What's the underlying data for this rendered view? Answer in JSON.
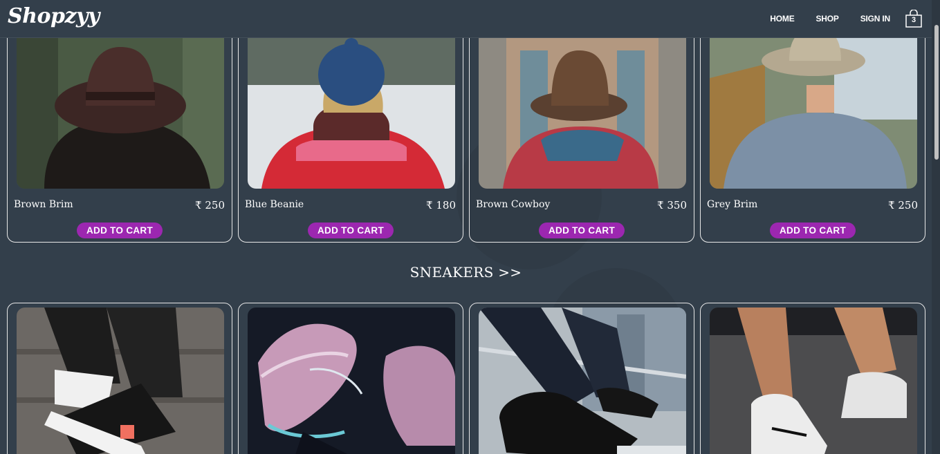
{
  "header": {
    "logo": "Shopzyy",
    "nav": [
      "HOME",
      "SHOP",
      "SIGN IN"
    ],
    "cart_count": "3"
  },
  "hats": [
    {
      "name": "Brown Brim",
      "price": "₹ 250",
      "cta": "ADD TO CART"
    },
    {
      "name": "Blue Beanie",
      "price": "₹ 180",
      "cta": "ADD TO CART"
    },
    {
      "name": "Brown Cowboy",
      "price": "₹ 350",
      "cta": "ADD TO CART"
    },
    {
      "name": "Grey Brim",
      "price": "₹ 250",
      "cta": "ADD TO CART"
    }
  ],
  "sneakers_section": {
    "title": "SNEAKERS >>"
  },
  "colors": {
    "background": "#333f4b",
    "accent": "#9c27b0"
  }
}
